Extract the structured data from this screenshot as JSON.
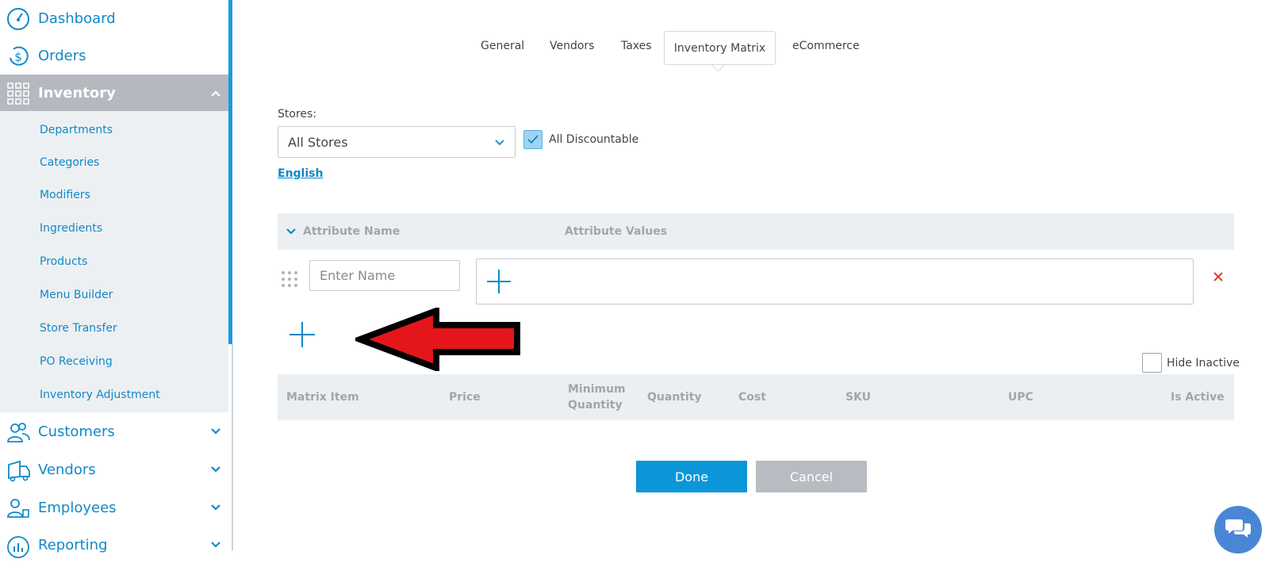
{
  "sidebar": {
    "items": [
      {
        "label": "Dashboard",
        "icon": "dashboard-gauge-icon"
      },
      {
        "label": "Orders",
        "icon": "dollar-refresh-icon"
      },
      {
        "label": "Inventory",
        "icon": "grid-icon",
        "expanded": true
      },
      {
        "label": "Customers",
        "icon": "customers-icon"
      },
      {
        "label": "Vendors",
        "icon": "truck-icon"
      },
      {
        "label": "Employees",
        "icon": "employees-icon"
      },
      {
        "label": "Reporting",
        "icon": "reporting-icon"
      }
    ],
    "inventory_sub": [
      "Departments",
      "Categories",
      "Modifiers",
      "Ingredients",
      "Products",
      "Menu Builder",
      "Store Transfer",
      "PO Receiving",
      "Inventory Adjustment"
    ]
  },
  "tabs": [
    "General",
    "Vendors",
    "Taxes",
    "Inventory Matrix",
    "eCommerce"
  ],
  "active_tab": "Inventory Matrix",
  "form": {
    "stores_label": "Stores:",
    "stores_value": "All Stores",
    "discountable_label": "All Discountable",
    "discountable_checked": true,
    "language_link": "English"
  },
  "attributes": {
    "header_name": "Attribute Name",
    "header_values": "Attribute Values",
    "name_placeholder": "Enter Name"
  },
  "matrix": {
    "hide_inactive_label": "Hide Inactive",
    "columns": [
      "Matrix Item",
      "Price",
      "Minimum",
      "Quantity",
      "Quantity",
      "Cost",
      "SKU",
      "UPC",
      "Is Active"
    ]
  },
  "buttons": {
    "done": "Done",
    "cancel": "Cancel"
  },
  "colors": {
    "accent": "#0b96d9",
    "active_nav": "#b4b9c0",
    "remove": "#e53935",
    "arrow": "#e5161b"
  }
}
